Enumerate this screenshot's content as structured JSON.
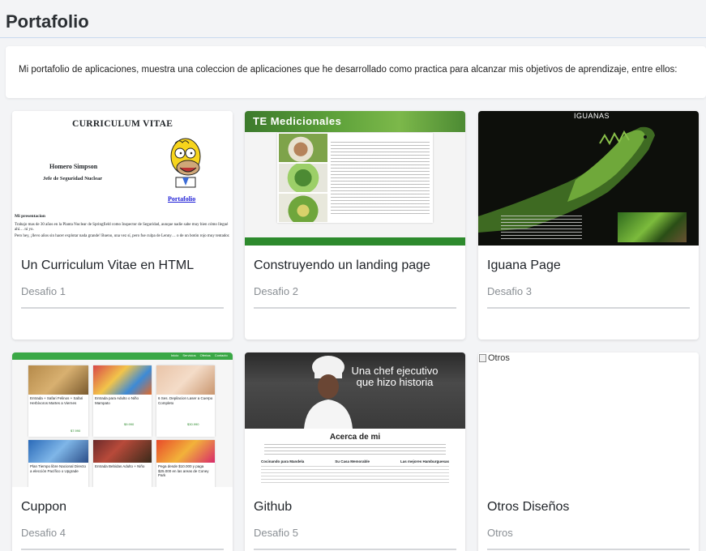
{
  "page": {
    "title": "Portafolio",
    "intro": "Mi portafolio de aplicaciones, muestra una coleccion de aplicaciones que he desarrollado como practica para alcanzar mis objetivos de aprendizaje, entre ellos:"
  },
  "cards": [
    {
      "title": "Un Curriculum Vitae en HTML",
      "subtitle": "Desafio 1",
      "thumb": {
        "heading": "CURRICULUM VITAE",
        "name": "Homero Simpson",
        "role": "Jefe de Seguridad Nuclear",
        "link": "Portafolio",
        "section": "Mi presentacion",
        "text1": "Trabajo mas de 30 años en la Planta Nuclear de Springfield como Inspector de Seguridad, aunque nadie sabe muy bien cómo llegué ahí… ni yo.",
        "text2": "Pero hey, ¡llevo años sin hacer explotar nada grande! Bueno, una vez sí, pero fue culpa de Lenny… o de un botón rojo muy tentador."
      }
    },
    {
      "title": "Construyendo un landing page",
      "subtitle": "Desafio 2",
      "thumb": {
        "heading": "TE Medicionales"
      }
    },
    {
      "title": "Iguana Page",
      "subtitle": "Desafio 3",
      "thumb": {
        "heading": "IGUANAS"
      }
    },
    {
      "title": "Cuppon",
      "subtitle": "Desafio 4",
      "thumb": {
        "nav": [
          "Inicio",
          "Servicios",
          "Ofertas",
          "Contacto"
        ],
        "deals": [
          "Entrada + Safari Felinos + Safari Herbívoros Martes a Viernes",
          "Entrada para Adulto o Niño Mampato",
          "6 Ses. Depilacion Laser a Cuerpo Completo",
          "Plan Tiempo libre Nacional Directo a elección Pacífico o Upgrade",
          "Entrada Bebidas Adulto + Niño",
          "Pega desde $10.000 y paga $25.000 en las areas de Coney Park"
        ],
        "prices": [
          "$7.990",
          "$9.990",
          "$30.990"
        ]
      }
    },
    {
      "title": "Github",
      "subtitle": "Desafio 5",
      "thumb": {
        "banner": "Una chef ejecutivo que hizo historia",
        "section": "Acerca de mi",
        "features": [
          "Cocinando para Mandela",
          "Su Casa Memorable",
          "Las mejores Hamburguesas"
        ]
      }
    },
    {
      "title": "Otros Diseños",
      "subtitle": "Otros",
      "thumb": {
        "alt": "Otros"
      }
    }
  ]
}
